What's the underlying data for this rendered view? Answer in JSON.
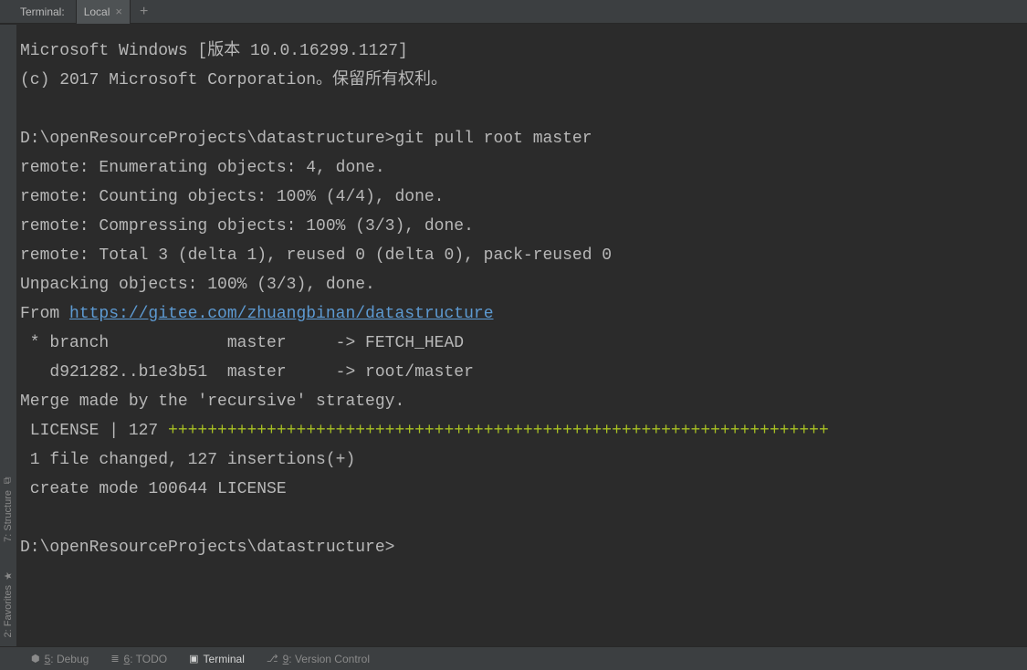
{
  "header": {
    "terminal_label": "Terminal:",
    "tab_label": "Local",
    "close_glyph": "×",
    "add_glyph": "+"
  },
  "gutter": {
    "structure": "7: Structure",
    "favorites": "2: Favorites"
  },
  "terminal": {
    "line1": "Microsoft Windows [版本 10.0.16299.1127]",
    "line2": "(c) 2017 Microsoft Corporation。保留所有权利。",
    "blank": " ",
    "prompt1": "D:\\openResourceProjects\\datastructure>git pull root master",
    "remote1": "remote: Enumerating objects: 4, done.",
    "remote2": "remote: Counting objects: 100% (4/4), done.",
    "remote3": "remote: Compressing objects: 100% (3/3), done.",
    "remote4": "remote: Total 3 (delta 1), reused 0 (delta 0), pack-reused 0",
    "unpack": "Unpacking objects: 100% (3/3), done.",
    "from_prefix": "From ",
    "from_url": "https://gitee.com/zhuangbinan/datastructure",
    "branch1": " * branch            master     -> FETCH_HEAD",
    "branch2": "   d921282..b1e3b51  master     -> root/master",
    "merge": "Merge made by the 'recursive' strategy.",
    "license_prefix": " LICENSE | 127 ",
    "license_pluses": "+++++++++++++++++++++++++++++++++++++++++++++++++++++++++++++++++++",
    "changed": " 1 file changed, 127 insertions(+)",
    "create": " create mode 100644 LICENSE",
    "prompt2": "D:\\openResourceProjects\\datastructure>"
  },
  "bottom": {
    "debug_num": "5",
    "debug_label": ": Debug",
    "todo_num": "6",
    "todo_label": ": TODO",
    "terminal_label": "Terminal",
    "vcs_num": "9",
    "vcs_label": ": Version Control"
  }
}
